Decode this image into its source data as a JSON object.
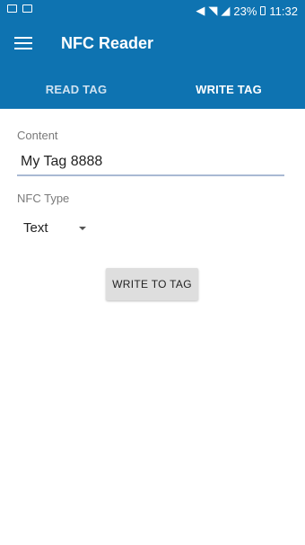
{
  "status_bar": {
    "left_icons": [
      "gallery-icon",
      "notification-icon"
    ],
    "right_icons": [
      "mute-icon",
      "wifi-icon",
      "signal-icon"
    ],
    "battery": "23%",
    "time": "11:32"
  },
  "toolbar": {
    "title": "NFC Reader",
    "menu_icon": "menu-icon"
  },
  "tabs": [
    {
      "label": "READ TAG",
      "active": false
    },
    {
      "label": "WRITE TAG",
      "active": true
    }
  ],
  "form": {
    "content_label": "Content",
    "content_value": "My Tag 8888",
    "nfc_type_label": "NFC Type",
    "nfc_type_value": "Text",
    "write_button": "WRITE TO TAG"
  },
  "colors": {
    "app_bar": "#0e73b1",
    "input_underline": "#a9b9d3",
    "button_bg": "#dedede"
  }
}
